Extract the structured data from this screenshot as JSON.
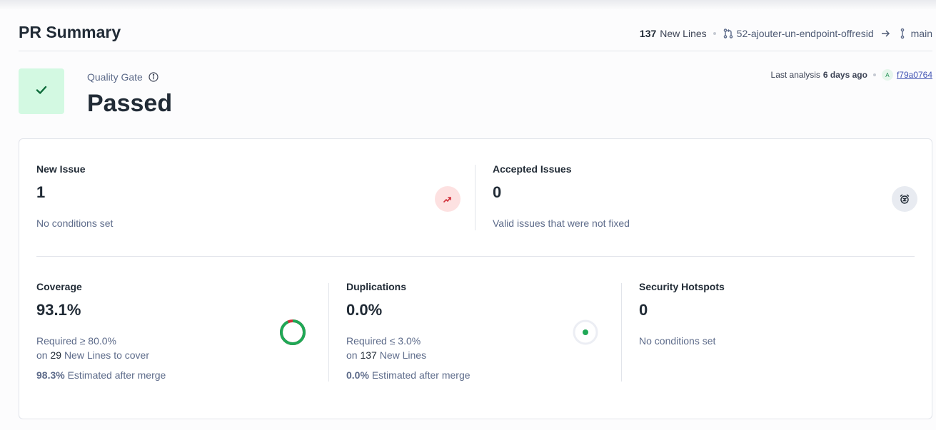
{
  "header": {
    "title": "PR Summary",
    "new_lines_count": "137",
    "new_lines_label": "New Lines",
    "source_branch": "52-ajouter-un-endpoint-offresid",
    "target_branch": "main"
  },
  "quality_gate": {
    "label": "Quality Gate",
    "status": "Passed",
    "status_color": "#d3f9e2"
  },
  "analysis": {
    "prefix": "Last analysis",
    "time": "6 days ago",
    "avatar_letter": "A",
    "commit": "f79a0764"
  },
  "metrics": {
    "new_issue": {
      "title": "New Issue",
      "value": "1",
      "subtitle": "No conditions set",
      "icon": "issue-trend-icon"
    },
    "accepted_issues": {
      "title": "Accepted Issues",
      "value": "0",
      "subtitle": "Valid issues that were not fixed",
      "icon": "alarm-clock-icon"
    },
    "coverage": {
      "title": "Coverage",
      "value": "93.1%",
      "required": "Required ≥ 80.0%",
      "on": "on",
      "lines_count": "29",
      "lines_label": "New Lines to cover",
      "estimate_value": "98.3%",
      "estimate_label": "Estimated after merge",
      "percent": 93.1
    },
    "duplications": {
      "title": "Duplications",
      "value": "0.0%",
      "required": "Required ≤ 3.0%",
      "on": "on",
      "lines_count": "137",
      "lines_label": "New Lines",
      "estimate_value": "0.0%",
      "estimate_label": "Estimated after merge"
    },
    "security_hotspots": {
      "title": "Security Hotspots",
      "value": "0",
      "subtitle": "No conditions set"
    }
  },
  "colors": {
    "passed_green": "#1fa856",
    "fail_red": "#d02f3a",
    "link": "#4456b4"
  }
}
